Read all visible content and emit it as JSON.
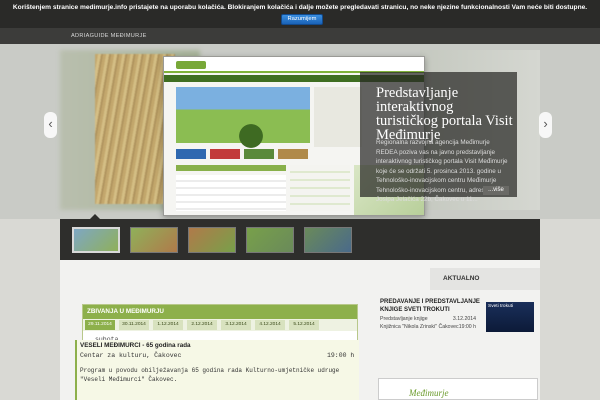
{
  "cookie": {
    "text": "Korištenjem stranice medimurje.info pristajete na uporabu kolačića. Blokiranjem kolačića i dalje možete pregledavati stranicu, no neke njezine funkcionalnosti Vam neće biti dostupne.",
    "button": "Razumijem"
  },
  "nav": {
    "item": "ADRIAGUIDE MEĐIMURJE"
  },
  "slider": {
    "caption_title": "Predstavljanje interaktivnog turističkog portala Visit Međimurje",
    "caption_body": "Regionalna razvojna agencija Međimurje REDEA poziva vas na javno predstavljanje interaktivnog turističkog portala Visit Međimurje koje će se održati 5. prosinca 2013. godine u Tehnološko-inovacijskom centru Međimurje Tehnološko-inovacijskom centru, adresi: Bana Josipa Jelačića 22b, Čakovec u 11...",
    "more": "...više",
    "prev_icon": "chevron-left-icon",
    "next_icon": "chevron-right-icon",
    "thumb_colors": [
      "#7ea7c4",
      "#8fb05a",
      "#b07a4a",
      "#78a04a",
      "#6a8a5a",
      "#4a6a8a"
    ]
  },
  "aktualno": "AKTUALNO",
  "calendar": {
    "header": "ZBIVANJA U MEĐIMURJU",
    "tabs": [
      "29.11.2014",
      "30.11.2014",
      "1.12.2014",
      "2.12.2014",
      "3.12.2014",
      "4.12.2014",
      "5.12.2014"
    ],
    "day": "subota",
    "event_title": "VESELI MEĐIMURCI - 65 godina rada",
    "event_location": "Centar za kulturu, Čakovec",
    "event_time": "19:00 h",
    "event_desc": "Program u povodu obilježavanja 65 godina rada Kulturno-umjetničke udruge \"Veseli Međimurci\" Čakovec."
  },
  "news": {
    "title": "PREDAVANJE I PREDSTAVLJANJE KNJIGE SVETI TROKUTI",
    "rows": [
      {
        "label": "Predstavljanje knjige",
        "value": "3.12.2014"
      },
      {
        "label": "Knjižnica \"Nikola Zrinski\" Čakovec",
        "value": "19:00 h"
      }
    ],
    "image_text": "Sveti trokuti"
  },
  "footer_logo": "Međimurje"
}
